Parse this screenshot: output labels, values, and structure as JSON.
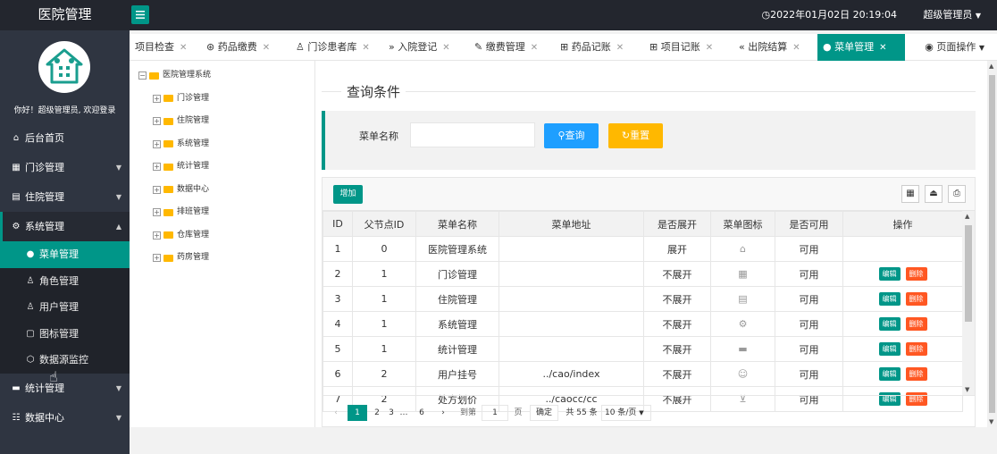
{
  "header": {
    "brand": "医院管理",
    "datetime": "2022年01月02日 20:19:04",
    "user": "超级管理员"
  },
  "sidebar": {
    "welcome": "你好！超级管理员, 欢迎登录",
    "items": [
      {
        "label": "后台首页",
        "icon": "home-icon"
      },
      {
        "label": "门诊管理",
        "icon": "grid-icon"
      },
      {
        "label": "住院管理",
        "icon": "building-icon"
      },
      {
        "label": "系统管理",
        "icon": "gear-icon"
      },
      {
        "label": "统计管理",
        "icon": "chart-icon"
      },
      {
        "label": "数据中心",
        "icon": "data-icon"
      }
    ],
    "sub_items": [
      {
        "label": "菜单管理",
        "icon": "dot-icon"
      },
      {
        "label": "角色管理",
        "icon": "user-icon"
      },
      {
        "label": "用户管理",
        "icon": "users-icon"
      },
      {
        "label": "图标管理",
        "icon": "image-icon"
      },
      {
        "label": "数据源监控",
        "icon": "cube-icon"
      }
    ]
  },
  "tabs": [
    {
      "label": "项目检查"
    },
    {
      "label": "药品缴费"
    },
    {
      "label": "门诊患者库"
    },
    {
      "label": "入院登记"
    },
    {
      "label": "缴费管理"
    },
    {
      "label": "药品记账"
    },
    {
      "label": "项目记账"
    },
    {
      "label": "出院结算"
    },
    {
      "label": "菜单管理"
    }
  ],
  "page_ops": "页面操作",
  "tree": {
    "root": "医院管理系统",
    "children": [
      "门诊管理",
      "住院管理",
      "系统管理",
      "统计管理",
      "数据中心",
      "排班管理",
      "仓库管理",
      "药房管理"
    ]
  },
  "query": {
    "legend": "查询条件",
    "label": "菜单名称",
    "value": "",
    "search_btn": "查询",
    "reset_btn": "重置"
  },
  "table": {
    "add_btn": "增加",
    "columns": [
      "ID",
      "父节点ID",
      "菜单名称",
      "菜单地址",
      "是否展开",
      "菜单图标",
      "是否可用",
      "操作"
    ],
    "edit_label": "编辑",
    "delete_label": "删除",
    "rows": [
      {
        "id": "1",
        "pid": "0",
        "name": "医院管理系统",
        "url": "",
        "expand": "展开",
        "icon": "⌂",
        "enabled": "可用",
        "ops": false
      },
      {
        "id": "2",
        "pid": "1",
        "name": "门诊管理",
        "url": "",
        "expand": "不展开",
        "icon": "▦",
        "enabled": "可用",
        "ops": true
      },
      {
        "id": "3",
        "pid": "1",
        "name": "住院管理",
        "url": "",
        "expand": "不展开",
        "icon": "▤",
        "enabled": "可用",
        "ops": true
      },
      {
        "id": "4",
        "pid": "1",
        "name": "系统管理",
        "url": "",
        "expand": "不展开",
        "icon": "⚙",
        "enabled": "可用",
        "ops": true
      },
      {
        "id": "5",
        "pid": "1",
        "name": "统计管理",
        "url": "",
        "expand": "不展开",
        "icon": "▬",
        "enabled": "可用",
        "ops": true
      },
      {
        "id": "6",
        "pid": "2",
        "name": "用户挂号",
        "url": "../cao/index",
        "expand": "不展开",
        "icon": "☺",
        "enabled": "可用",
        "ops": true
      },
      {
        "id": "7",
        "pid": "2",
        "name": "处方划价",
        "url": "../caocc/cc",
        "expand": "不展开",
        "icon": "⊻",
        "enabled": "可用",
        "ops": true
      }
    ]
  },
  "pager": {
    "pages": [
      "1",
      "2",
      "3",
      "…",
      "6"
    ],
    "goto_label": "到第",
    "goto_value": "1",
    "page_unit": "页",
    "confirm": "确定",
    "total": "共 55 条",
    "page_size": "10 条/页"
  },
  "colors": {
    "accent": "#009688",
    "blue": "#1e9fff",
    "yellow": "#ffb800",
    "danger": "#ff5722",
    "dark": "#23262e"
  }
}
